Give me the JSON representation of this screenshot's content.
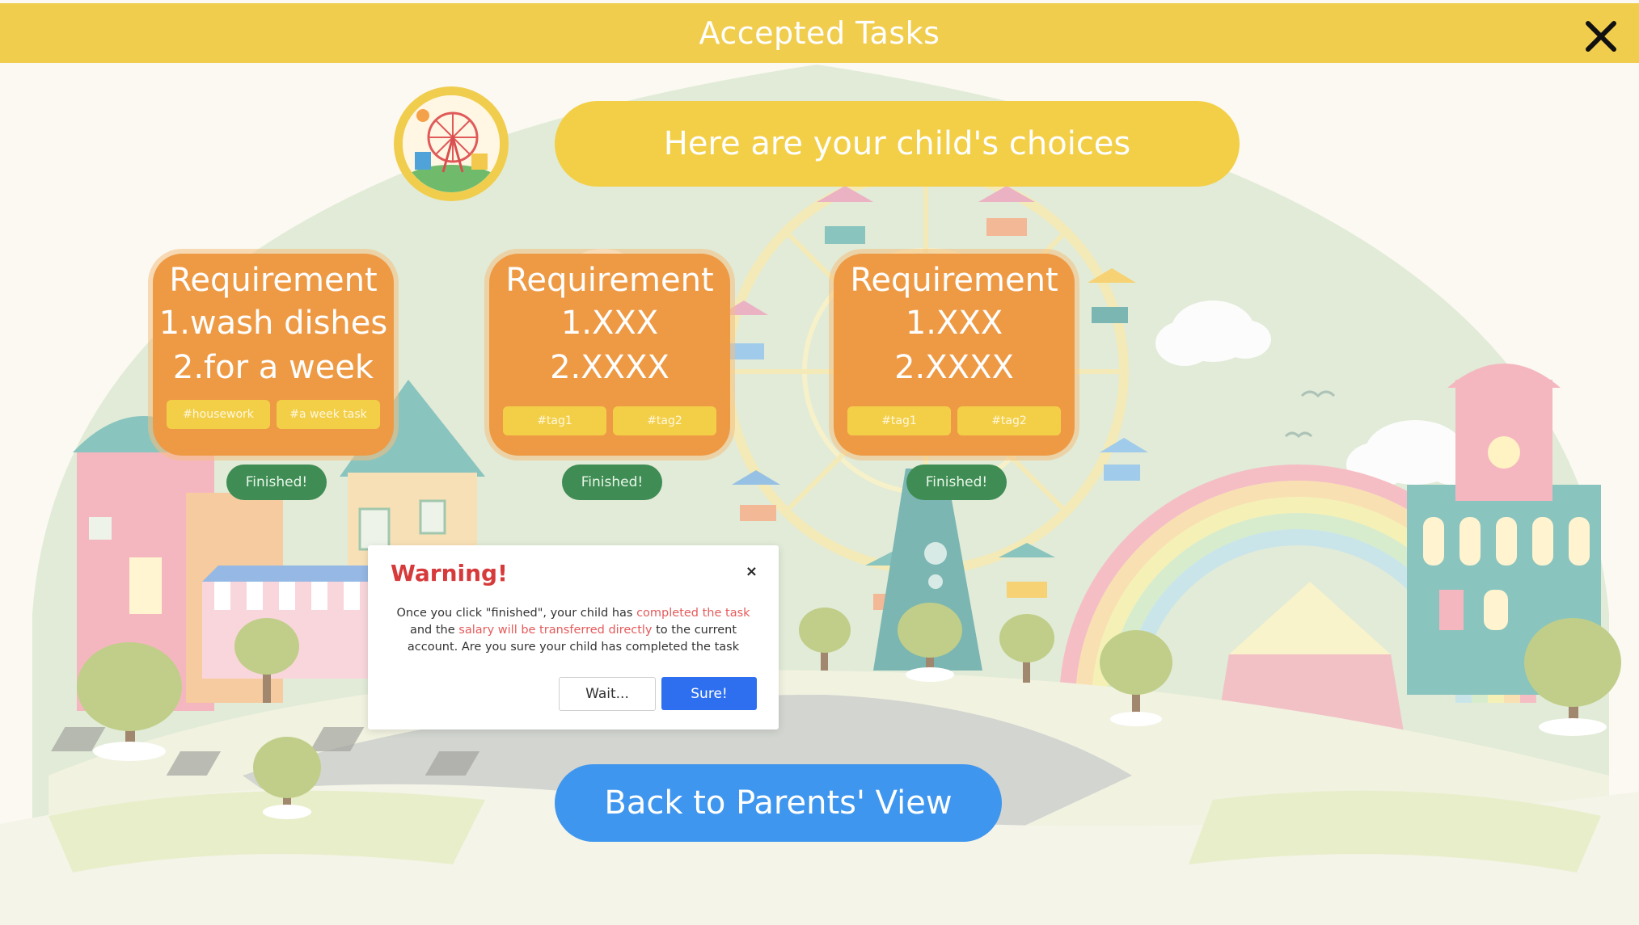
{
  "header": {
    "title": "Accepted Tasks",
    "close_icon": "close-icon"
  },
  "intro": {
    "subtitle": "Here are your child's choices",
    "avatar_icon": "ferris-wheel-icon"
  },
  "tasks": [
    {
      "title": "Requirement",
      "line1": "1.wash dishes",
      "line2": "2.for a week",
      "tags": [
        "#housework",
        "#a week task"
      ],
      "finish_label": "Finished!"
    },
    {
      "title": "Requirement",
      "line1": "1.XXX",
      "line2": "2.XXXX",
      "tags": [
        "#tag1",
        "#tag2"
      ],
      "finish_label": "Finished!"
    },
    {
      "title": "Requirement",
      "line1": "1.XXX",
      "line2": "2.XXXX",
      "tags": [
        "#tag1",
        "#tag2"
      ],
      "finish_label": "Finished!"
    }
  ],
  "warning": {
    "title": "Warning!",
    "close_label": "×",
    "msg_1": "Once you click \"finished\", your child has ",
    "msg_hl_1": "completed the task",
    "msg_2": " and the ",
    "msg_hl_2": "salary will be transferred directly",
    "msg_3": " to the current account. Are you sure your child has completed the task",
    "wait_label": "Wait...",
    "sure_label": "Sure!"
  },
  "footer": {
    "back_label": "Back to Parents' View"
  },
  "colors": {
    "header": "#f1cd4e",
    "card": "#ee9a45",
    "tag": "#f3cf47",
    "finish": "#3f8c54",
    "sure": "#2e6ff0",
    "back": "#3f96ee",
    "warning_text": "#d63a3a"
  }
}
